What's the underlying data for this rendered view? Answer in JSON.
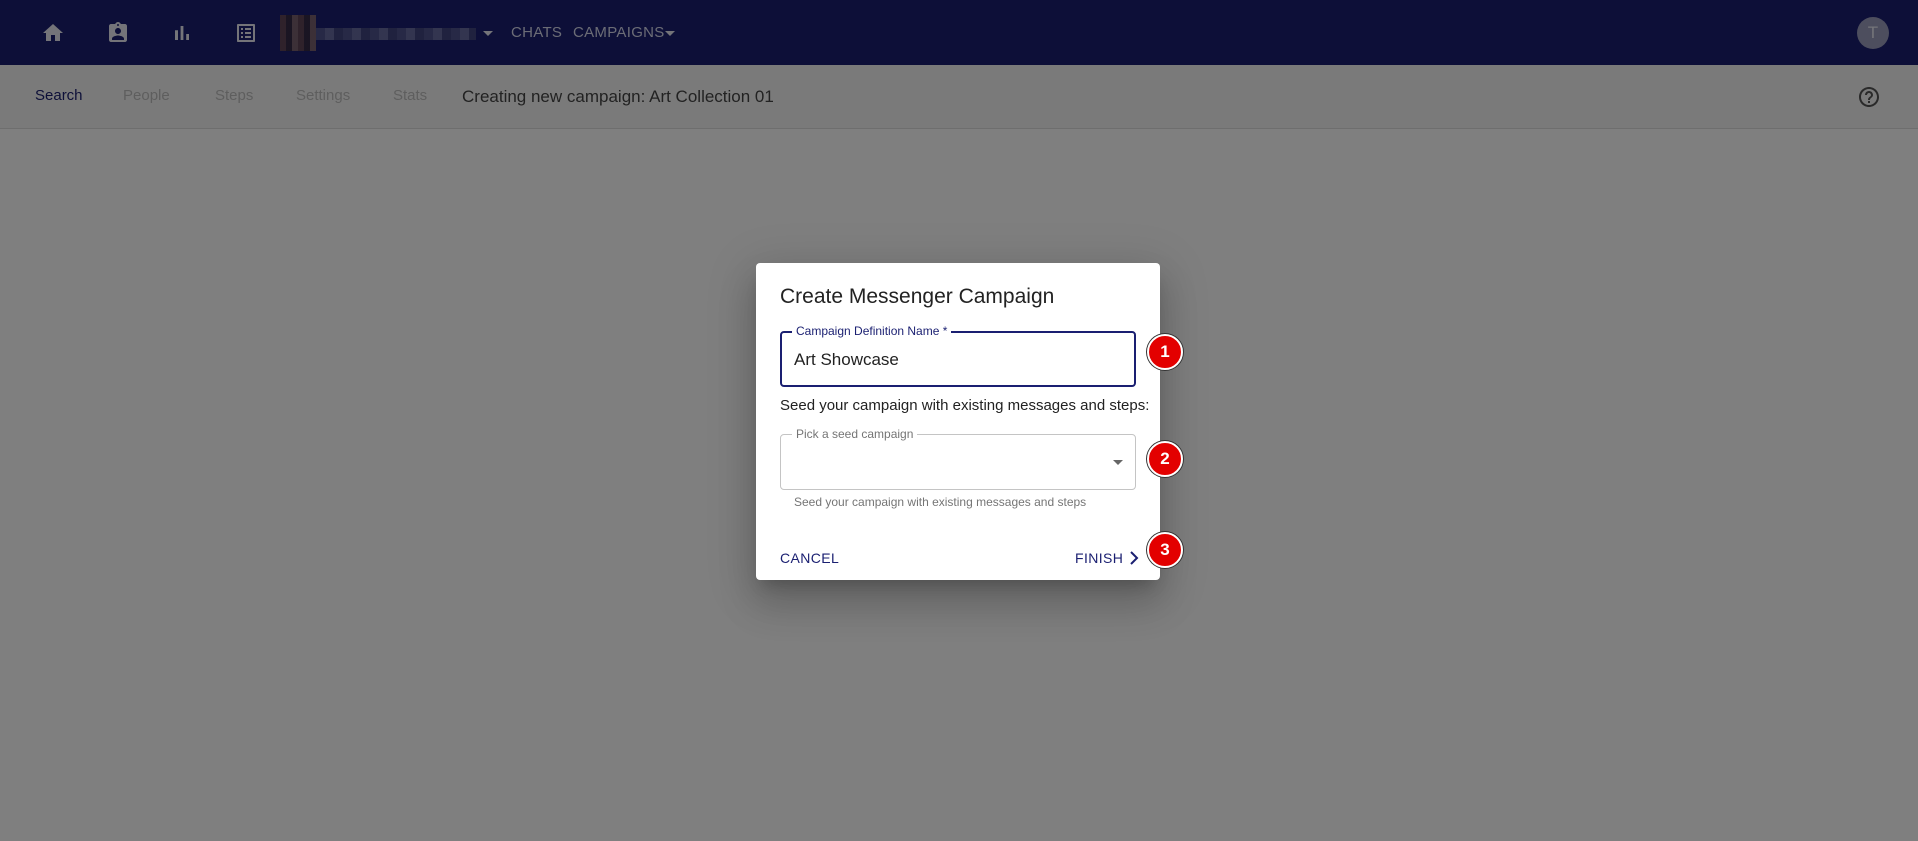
{
  "appbar": {
    "nav_icons": [
      "home-icon",
      "contact-badge-icon",
      "bar-chart-icon",
      "list-icon"
    ],
    "links": {
      "chats": "CHATS",
      "campaigns": "CAMPAIGNS"
    },
    "user_initial": "T",
    "color": "#1a1f71"
  },
  "subbar": {
    "tabs": [
      "Search",
      "People",
      "Steps",
      "Settings",
      "Stats"
    ],
    "active_tab": "Search",
    "crumb": "Creating new campaign: Art Collection 01",
    "help_icon": "help-circle-icon"
  },
  "dialog": {
    "title": "Create Messenger Campaign",
    "name_field": {
      "label": "Campaign Definition Name *",
      "value": "Art Showcase"
    },
    "seed_text": "Seed your campaign with existing messages and steps:",
    "seed_field": {
      "label": "Pick a seed campaign",
      "value": "",
      "helper": "Seed your campaign with existing messages and steps"
    },
    "cancel_label": "CANCEL",
    "finish_label": "FINISH"
  },
  "markers": [
    "1",
    "2",
    "3"
  ],
  "colors": {
    "accent": "#1a1f71",
    "marker": "#e30000",
    "scrim": "rgba(0,0,0,0.5)"
  }
}
